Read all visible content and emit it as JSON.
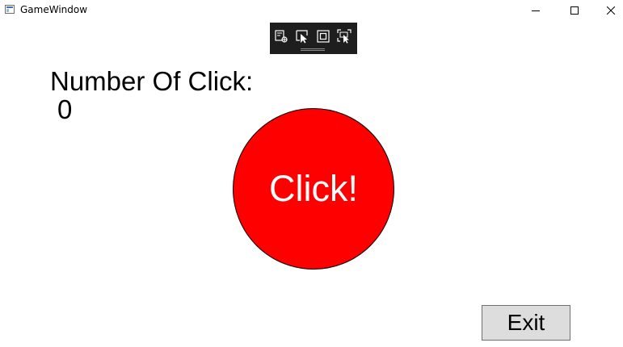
{
  "window": {
    "title": "GameWindow",
    "icon": "wpf-window-icon",
    "controls": {
      "minimize_icon": "minimize-icon",
      "maximize_icon": "maximize-icon",
      "close_icon": "close-icon"
    }
  },
  "debug_toolbar": {
    "icons": [
      "live-visual-tree-icon",
      "select-element-icon",
      "display-layout-adorners-icon",
      "track-focus-icon"
    ]
  },
  "game": {
    "count_label": "Number Of Click:",
    "count_value": "0",
    "click_button_label": "Click!",
    "exit_button_label": "Exit"
  },
  "colors": {
    "click_button_fill": "#ff0000",
    "click_button_text": "#ffffff",
    "exit_button_fill": "#dddddd",
    "debug_toolbar_bg": "#1e1e1e"
  }
}
